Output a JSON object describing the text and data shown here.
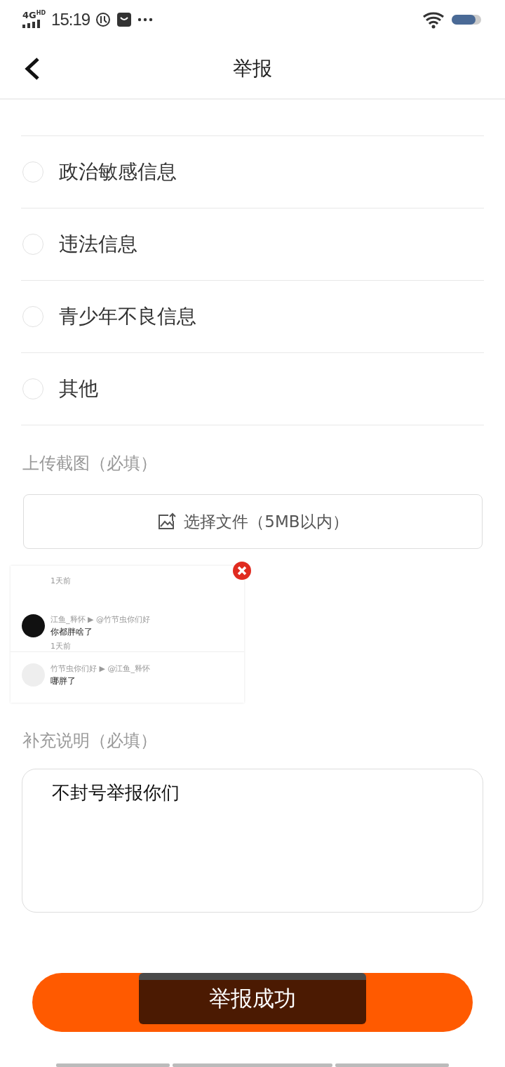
{
  "status_bar": {
    "network": "4G",
    "network_sup": "HD",
    "time": "15:19"
  },
  "header": {
    "title": "举报"
  },
  "options": [
    {
      "label": "政治敏感信息",
      "selected": false
    },
    {
      "label": "违法信息",
      "selected": false
    },
    {
      "label": "青少年不良信息",
      "selected": false
    },
    {
      "label": "其他",
      "selected": false
    }
  ],
  "upload": {
    "label": "上传截图（必填）",
    "button": "选择文件（5MB以内）"
  },
  "screenshot": {
    "arrow": "▶",
    "comments": [
      {
        "kind": "cut",
        "time": "1天前"
      },
      {
        "kind": "avatar",
        "user": "江鱼_释怀",
        "reply_to": "@竹节虫你们好",
        "text": "你都胖啥了",
        "time": "1天前"
      },
      {
        "kind": "plain",
        "user": "竹节虫你们好",
        "reply_to": "@江鱼_释怀",
        "text": "哪胖了"
      }
    ]
  },
  "note": {
    "label": "补充说明（必填）",
    "value": "不封号举报你们"
  },
  "toast": {
    "text": "举报成功"
  }
}
